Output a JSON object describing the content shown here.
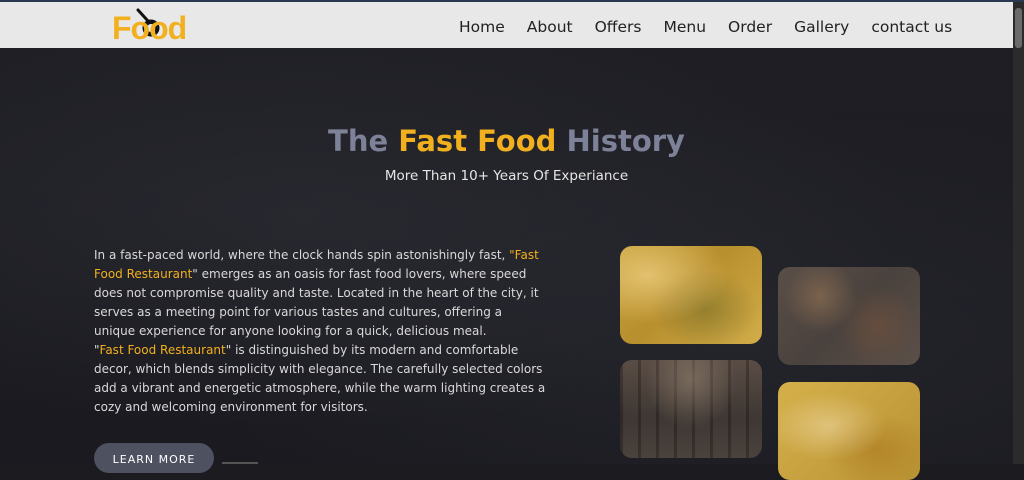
{
  "logo": {
    "text": "Food"
  },
  "nav": {
    "items": [
      "Home",
      "About",
      "Offers",
      "Menu",
      "Order",
      "Gallery",
      "contact us"
    ]
  },
  "hero": {
    "title_prefix": "The ",
    "title_accent": "Fast Food",
    "title_suffix": " History",
    "subtitle": "More Than 10+ Years Of Experiance"
  },
  "about": {
    "p1_a": "In a fast-paced world, where the clock hands spin astonishingly fast, ",
    "p1_hl": "\"Fast Food Restaurant",
    "p1_b": "\" emerges as an oasis for fast food lovers, where speed does not compromise quality and taste. Located in the heart of the city, it serves as a meeting point for various tastes and cultures, offering a unique experience for anyone looking for a quick, delicious meal.",
    "p2_a": "\"",
    "p2_hl": "Fast Food Restaurant",
    "p2_b": "\" is distinguished by its modern and comfortable decor, which blends simplicity with elegance. The carefully selected colors add a vibrant and energetic atmosphere, while the warm lighting creates a cozy and welcoming environment for visitors.",
    "button": "LEARN MORE"
  },
  "colors": {
    "accent": "#f2b01e",
    "title_muted": "#7e8299",
    "navbar_bg": "#e8e8e8",
    "page_bg": "#1b1b20"
  },
  "gallery": [
    {
      "name": "food-photo"
    },
    {
      "name": "food-photo"
    },
    {
      "name": "restaurant-interior-photo"
    },
    {
      "name": "food-photo"
    }
  ]
}
